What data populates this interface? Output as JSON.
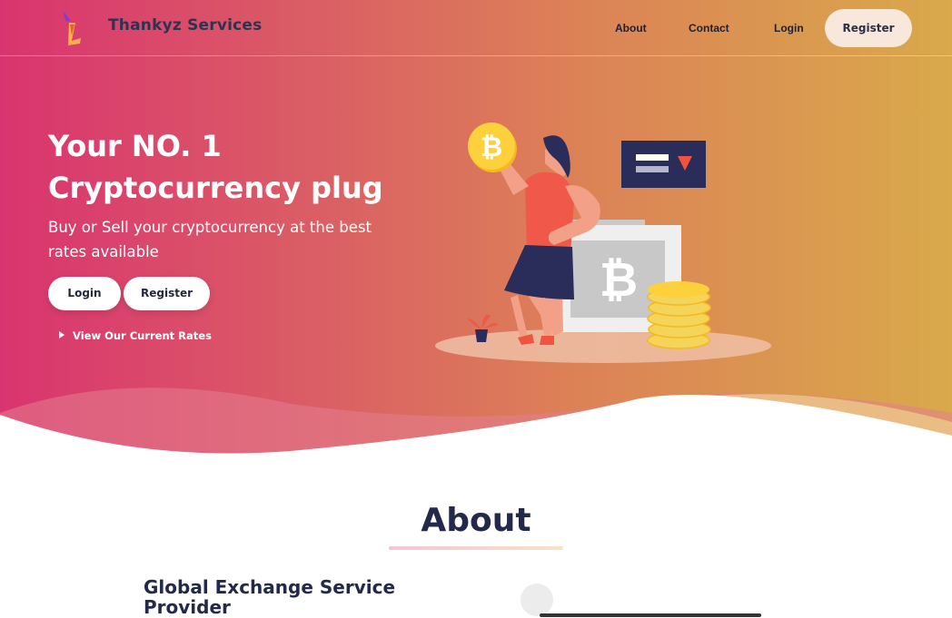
{
  "brand": {
    "name": "Thankyz Services"
  },
  "nav": {
    "about": "About",
    "contact": "Contact",
    "login": "Login",
    "register": "Register"
  },
  "hero": {
    "headline": "Your NO. 1 Cryptocurrency plug",
    "subline": "Buy or Sell your cryptocurrency at the best rates available",
    "login_button": "Login",
    "register_button": "Register",
    "rates_link": "View Our Current Rates"
  },
  "about": {
    "title": "About",
    "heading": "Global Exchange Service Provider"
  },
  "icons": {
    "logo": "brand-logo-icon",
    "rates_arrow": "play-triangle-icon",
    "bitcoin": "bitcoin-icon"
  },
  "colors": {
    "hero_start": "#d9346f",
    "hero_end": "#d9a94b",
    "register_pill": "#f7e8db",
    "text_dark": "#22294a"
  }
}
